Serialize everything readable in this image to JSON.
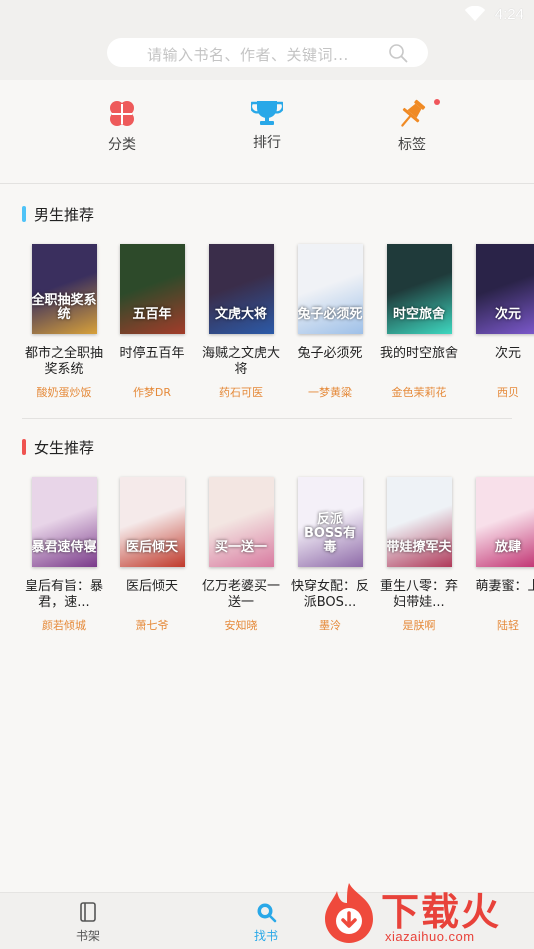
{
  "status_bar": {
    "time": "4:24"
  },
  "search": {
    "placeholder": "请输入书名、作者、关键词..."
  },
  "quick_nav": [
    {
      "label": "分类",
      "icon": "clover-icon"
    },
    {
      "label": "排行",
      "icon": "trophy-icon"
    },
    {
      "label": "标签",
      "icon": "pushpin-icon"
    }
  ],
  "sections": {
    "male": {
      "title": "男生推荐",
      "accent": "#4fc3f7",
      "books": [
        {
          "title": "都市之全职抽奖系统",
          "author": "酸奶蛋炒饭",
          "cover_text": "全职抽奖系统",
          "colors": [
            "#3a2f5e",
            "#d8a13a"
          ]
        },
        {
          "title": "时停五百年",
          "author": "作梦DR",
          "cover_text": "五百年",
          "colors": [
            "#2d4a2a",
            "#a33c2a"
          ]
        },
        {
          "title": "海贼之文虎大将",
          "author": "药石可医",
          "cover_text": "文虎大将",
          "colors": [
            "#3a2d4a",
            "#2c5aa8"
          ]
        },
        {
          "title": "兔子必须死",
          "author": "一梦黄粱",
          "cover_text": "兔子必须死",
          "colors": [
            "#f0f2f6",
            "#9ec0e8"
          ]
        },
        {
          "title": "我的时空旅舍",
          "author": "金色茉莉花",
          "cover_text": "时空旅舍",
          "colors": [
            "#1f3a3a",
            "#3ed8c0"
          ]
        },
        {
          "title": "次元",
          "author": "西贝",
          "cover_text": "次元",
          "colors": [
            "#2a2348",
            "#7e5ad0"
          ]
        }
      ]
    },
    "female": {
      "title": "女生推荐",
      "accent": "#ef5350",
      "books": [
        {
          "title": "皇后有旨：暴君，速...",
          "author": "颜若倾城",
          "cover_text": "暴君速侍寝",
          "colors": [
            "#e8d5e8",
            "#7a3a8a"
          ]
        },
        {
          "title": "医后倾天",
          "author": "萧七爷",
          "cover_text": "医后倾天",
          "colors": [
            "#f5eaea",
            "#c0392b"
          ]
        },
        {
          "title": "亿万老婆买一送一",
          "author": "安知晓",
          "cover_text": "买一送一",
          "colors": [
            "#f3e6e2",
            "#d87aa0"
          ]
        },
        {
          "title": "快穿女配：反派BOS...",
          "author": "墨泠",
          "cover_text": "反派BOSS有毒",
          "colors": [
            "#f4f0f8",
            "#8e6aa8"
          ]
        },
        {
          "title": "重生八零：弃妇带娃...",
          "author": "是朕啊",
          "cover_text": "带娃撩军夫",
          "colors": [
            "#eef2f6",
            "#b03a5a"
          ]
        },
        {
          "title": "萌妻蜜：上",
          "author": "陆轻",
          "cover_text": "放肆",
          "colors": [
            "#f8e0ea",
            "#c03070"
          ]
        }
      ]
    }
  },
  "bottom_nav": [
    {
      "label": "书架",
      "icon": "bookshelf-icon",
      "active": false
    },
    {
      "label": "找书",
      "icon": "search-icon",
      "active": true
    }
  ],
  "colors": {
    "active": "#29a8e8",
    "inactive": "#555555",
    "author": "#e58a3a"
  },
  "watermark": {
    "brand": "下载火",
    "url": "xiazaihuo.com"
  }
}
